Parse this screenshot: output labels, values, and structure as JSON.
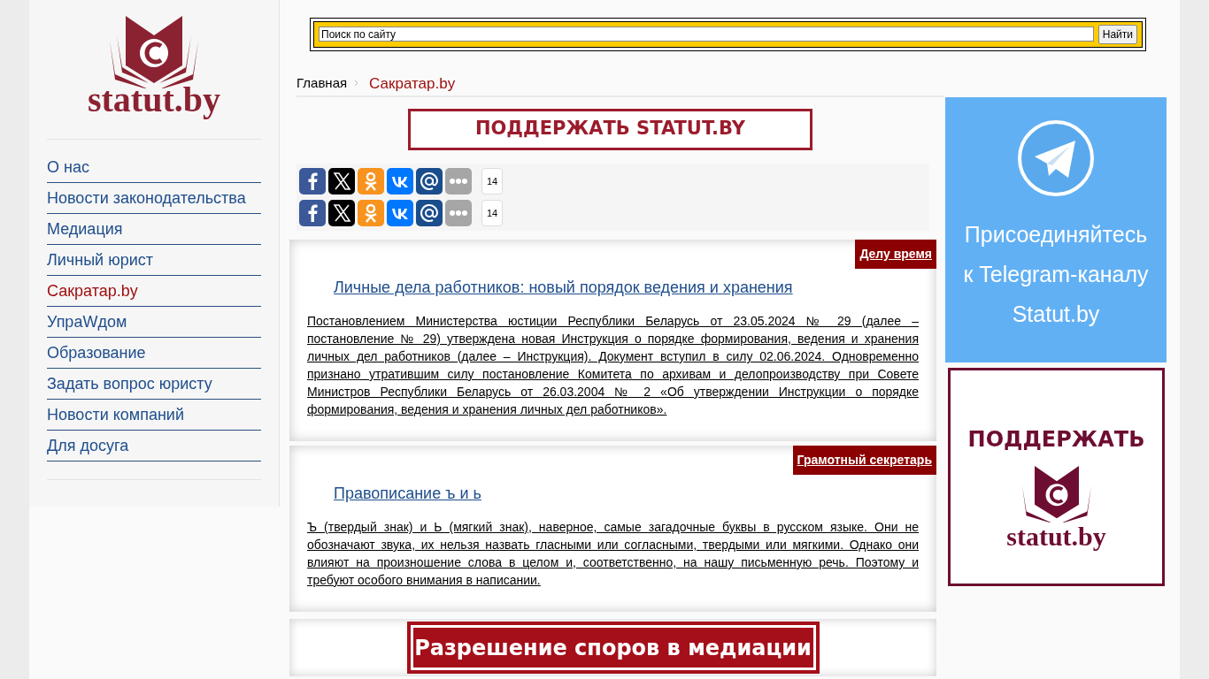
{
  "sidebar": {
    "logo_text": "statut.by",
    "items": [
      {
        "label": "О нас",
        "selected": false
      },
      {
        "label": "Новости законодательства",
        "selected": false
      },
      {
        "label": "Медиация",
        "selected": false
      },
      {
        "label": "Личный юрист",
        "selected": false
      },
      {
        "label": "Сакратар.by",
        "selected": true
      },
      {
        "label": "УпраWдом",
        "selected": false
      },
      {
        "label": "Образование",
        "selected": false
      },
      {
        "label": "Задать вопрос юристу",
        "selected": false
      },
      {
        "label": "Новости компаний",
        "selected": false
      },
      {
        "label": "Для досуга",
        "selected": false
      }
    ]
  },
  "search": {
    "placeholder": "Поиск по сайту",
    "button": "Найти"
  },
  "breadcrumb": [
    {
      "label": "Главная",
      "current": false
    },
    {
      "label": "Сакратар.by",
      "current": true
    }
  ],
  "top_banner": "ПОДДЕРЖАТЬ STATUT.BY",
  "share_rows": [
    {
      "services": [
        {
          "kind": "facebook"
        },
        {
          "kind": "x"
        },
        {
          "kind": "odnoklassniki"
        },
        {
          "kind": "vk"
        },
        {
          "kind": "mail"
        },
        {
          "kind": "more"
        }
      ],
      "count": "14"
    },
    {
      "services": [
        {
          "kind": "facebook"
        },
        {
          "kind": "x"
        },
        {
          "kind": "odnoklassniki"
        },
        {
          "kind": "vk"
        },
        {
          "kind": "mail"
        },
        {
          "kind": "more"
        }
      ],
      "count": "14"
    }
  ],
  "articles": [
    {
      "tag": "Делу время",
      "title": "Личные дела работников: новый порядок ведения и хранения",
      "body": "Постановлением Министерства юстиции Республики Беларусь от 23.05.2024 №  29 (далее – постановление № 29) утверждена новая Инструкция о порядке формирования, ведения и хранения личных дел работников (далее – Инструкция). Документ вступил в силу 02.06.2024. Одновременно признано утратившим силу постановление Комитета по архивам и делопроизводству при Совете Министров Республики Беларусь от 26.03.2004 №  2 «Об утверждении Инструкции о порядке формирования, ведения и хранения личных дел работников»."
    },
    {
      "tag": "Грамотный секретарь",
      "title": "Правописание ъ и ь",
      "body": "Ъ (твердый знак) и Ь (мягкий знак), наверное, самые загадочные буквы в русском языке. Они не обозначают звука, их нельзя назвать гласными или согласными, твердыми или мягкими. Однако они влияют на произношение слова в целом и, соответственно, на нашу письменную речь. Поэтому и требуют особого внимания в написании."
    }
  ],
  "bottom_banner": "Разрешение споров в медиации",
  "telegram_banner": {
    "lines": [
      "Присоединяйтесь",
      "к Telegram-каналу",
      "Statut.by"
    ]
  },
  "support_banner": {
    "title": "ПОДДЕРЖАТЬ",
    "logo_text": "statut.by"
  }
}
